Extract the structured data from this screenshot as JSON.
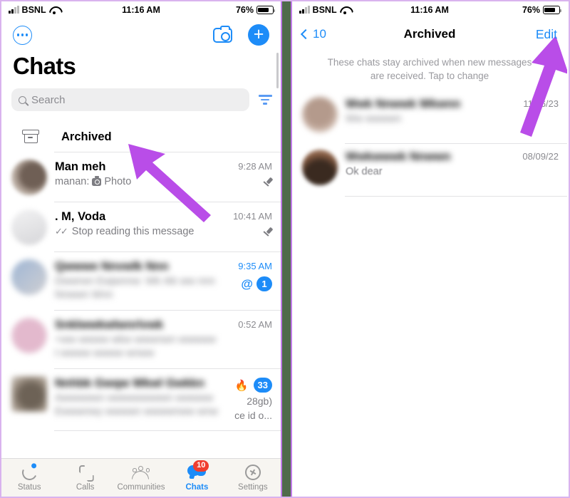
{
  "status_bar": {
    "carrier": "BSNL",
    "time": "11:16 AM",
    "battery_percent": "76%",
    "signal_icon": "cellular-signal-icon",
    "wifi_icon": "wifi-icon",
    "battery_icon": "battery-icon"
  },
  "colors": {
    "accent_blue": "#1d8cf8",
    "arrow_purple": "#b94de8",
    "badge_red": "#f03e2f",
    "divider_green": "#4f6b4a",
    "frame_purple": "#d9b3ee"
  },
  "left_phone": {
    "nav": {
      "more_icon": "more-circle-icon",
      "camera_icon": "camera-icon",
      "new_chat_label": "+"
    },
    "title": "Chats",
    "search": {
      "placeholder": "Search",
      "search_icon": "magnifier-icon",
      "filter_icon": "filter-icon"
    },
    "archived_row": {
      "label": "Archived",
      "icon": "archive-box-icon"
    },
    "chats": [
      {
        "name": "Man meh",
        "message": "manan:",
        "attachment": "Photo",
        "time": "9:28 AM",
        "pinned": true,
        "blurred": false,
        "avatar_color": "#8c7d72"
      },
      {
        "name": ". M, Voda",
        "message": "Stop reading this message",
        "ticks": "✓✓",
        "time": "10:41 AM",
        "pinned": true,
        "blurred": false,
        "avatar_color": "#dcdcde"
      },
      {
        "name": "Qwwwe Nnvwlk Nnn",
        "message": "Dwwrwn Ewjwnnw:  Wk rkk ww nnn",
        "message2": "Nnwwn Wnn",
        "time": "9:35 AM",
        "time_blue": true,
        "mention": "@",
        "badge": "1",
        "blurred": true,
        "avatar_color": "#9fb6d4"
      },
      {
        "name": "Snklwwkwlwnrlvwk",
        "message": "+ww wwww wkw wwwnwn wwwww",
        "message2": "t wwww wwww wnww",
        "time": "0:52 AM",
        "blurred": true,
        "avatar_color": "#e7c7d6"
      },
      {
        "name": "Nnhbk Gwqw Wkwl Gwkkn",
        "message": "Awwwwwn wwwwwwwwn  wwwww",
        "message2": "Ewwwnwy  wwwwn wwwwnww wnw",
        "time_extra": "28gb)",
        "message_tail": "ce id o...",
        "fire": "🔥",
        "badge": "33",
        "blurred": true,
        "avatar_color": "#8d8275"
      }
    ],
    "tabs": [
      {
        "label": "Status",
        "icon": "status-ring-icon",
        "active": false,
        "badge": ""
      },
      {
        "label": "Calls",
        "icon": "phone-icon",
        "active": false,
        "badge": ""
      },
      {
        "label": "Communities",
        "icon": "communities-icon",
        "active": false,
        "badge": ""
      },
      {
        "label": "Chats",
        "icon": "chat-bubbles-icon",
        "active": true,
        "badge": "10"
      },
      {
        "label": "Settings",
        "icon": "gear-icon",
        "active": false,
        "badge": ""
      }
    ]
  },
  "right_phone": {
    "nav": {
      "back_label": "10",
      "back_icon": "chevron-left-icon",
      "title": "Archived",
      "edit_label": "Edit"
    },
    "note": "These chats stay archived when new messages are received. Tap to change",
    "chats": [
      {
        "name": "Wwk Nnwwk Wkwnn",
        "message": "Ww  wwwwn",
        "date": "11/06/23",
        "blurred": true,
        "avatar_color": "#cdb2a6"
      },
      {
        "name": "Wwkwwwk  Nnwwn",
        "message": "Ok dear",
        "date": "08/09/22",
        "blurred": true,
        "avatar_color": "#6a4a38"
      }
    ]
  },
  "annotations": [
    {
      "name": "arrow-to-archived-row",
      "color": "#b94de8"
    },
    {
      "name": "arrow-to-edit-button",
      "color": "#b94de8"
    }
  ]
}
